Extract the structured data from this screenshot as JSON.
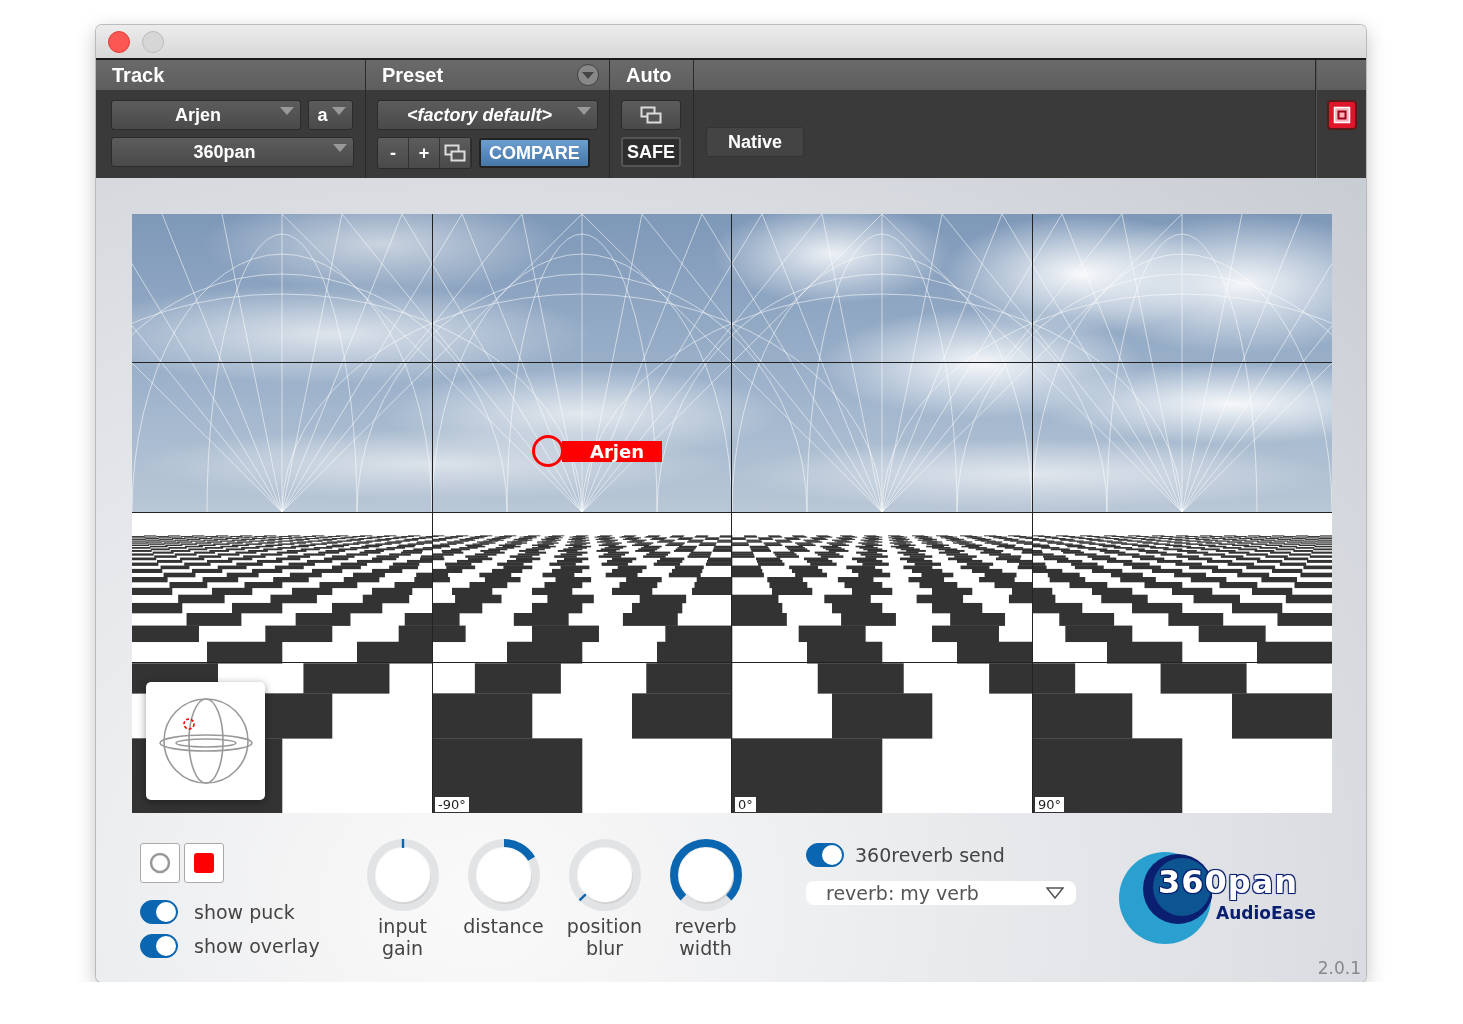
{
  "window": {
    "buttons": [
      {
        "kind": "close"
      },
      {
        "kind": "minimize"
      }
    ]
  },
  "header": {
    "track": {
      "label": "Track",
      "track_name": "Arjen",
      "channel": "a",
      "plugin": "360pan"
    },
    "preset": {
      "label": "Preset",
      "name": "<factory default>",
      "decrement": "-",
      "increment": "+",
      "compare": {
        "label": "COMPARE",
        "on": true
      }
    },
    "auto": {
      "label": "Auto",
      "safe": "SAFE",
      "mode": "Native"
    },
    "bypass": {
      "on": true
    }
  },
  "viewport": {
    "puck": {
      "label": "Arjen"
    },
    "azimuth_labels": [
      "-90°",
      "0°",
      "90°"
    ]
  },
  "controls": {
    "view_buttons": [
      {
        "kind": "circle"
      },
      {
        "kind": "square"
      }
    ],
    "toggles": [
      {
        "label": "show puck",
        "on": true
      },
      {
        "label": "show overlay",
        "on": true
      }
    ],
    "knobs": [
      {
        "label": "input gain",
        "kind": "bipolar",
        "level": 0.5
      },
      {
        "label": "distance",
        "kind": "bipolar",
        "level": 0.72
      },
      {
        "label": "position blur",
        "kind": "unipolar",
        "level": 0.0
      },
      {
        "label": "reverb width",
        "kind": "unipolar",
        "level": 1.0
      }
    ],
    "reverb_send": {
      "label": "360reverb send",
      "on": true
    },
    "reverb_select": {
      "value": "reverb: my verb"
    },
    "logo": {
      "wordmark": "360pan",
      "brand": "AudioEase"
    },
    "version": "2.0.1"
  }
}
